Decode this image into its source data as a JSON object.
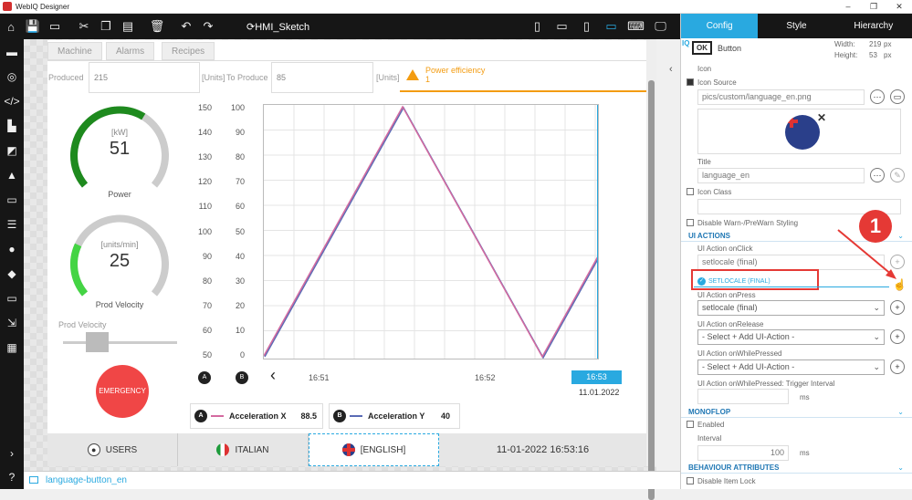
{
  "window": {
    "title": "WebIQ Designer",
    "controls": [
      "–",
      "❐",
      "✕"
    ]
  },
  "toolbar": {
    "project": "HMI_Sketch",
    "icons": [
      "home-icon",
      "save-icon",
      "monitor-icon",
      "cut-icon",
      "copy-icon",
      "paste-icon",
      "delete-icon",
      "undo-icon",
      "redo-icon"
    ],
    "devices": [
      "phone-portrait-icon",
      "phone-landscape-icon",
      "tablet-portrait-icon",
      "tablet-landscape-icon",
      "laptop-icon",
      "desktop-icon"
    ]
  },
  "sidebar": {
    "icons": [
      "widgets-icon",
      "globe-icon",
      "code-icon",
      "factory-icon",
      "trend-icon",
      "alarm-icon",
      "tag-icon",
      "list-icon",
      "user-icon",
      "cube-icon",
      "screen-icon",
      "import-icon",
      "grid-icon"
    ],
    "bottom": [
      "chevron-right-icon",
      "help-icon"
    ]
  },
  "hmi": {
    "tabs": [
      "Machine",
      "Alarms",
      "Recipes"
    ],
    "produced": {
      "label": "Produced",
      "value": "215",
      "unit": "[Units]"
    },
    "to_produce": {
      "label": "To Produce",
      "value": "85",
      "unit": "[Units]"
    },
    "warning": {
      "title": "Power efficiency",
      "value": "1"
    },
    "gauge1": {
      "unit": "[kW]",
      "value": "51",
      "label": "Power",
      "fraction": 0.62,
      "color": "#1e8a1e"
    },
    "gauge2": {
      "unit": "[units/min]",
      "value": "25",
      "label": "Prod Velocity",
      "fraction": 0.25,
      "color": "#44d444"
    },
    "slider": {
      "label": "Prod Velocity",
      "fraction": 0.25
    },
    "emergency": "EMERGENCY",
    "axis_a": [
      "150",
      "140",
      "130",
      "120",
      "110",
      "100",
      "90",
      "80",
      "70",
      "60",
      "50"
    ],
    "axis_b": [
      "100",
      "90",
      "80",
      "70",
      "60",
      "50",
      "40",
      "30",
      "20",
      "10",
      "0"
    ],
    "x_labels": [
      "16:51",
      "16:52",
      "16:53"
    ],
    "date": "11.01.2022",
    "marker_a": "A",
    "marker_b": "B",
    "nav_prev": "‹",
    "legend": [
      {
        "marker": "A",
        "name": "Acceleration X",
        "value": "88.5",
        "color": "#d46aa0"
      },
      {
        "marker": "B",
        "name": "Acceleration Y",
        "value": "40",
        "color": "#5a6bb5"
      }
    ],
    "bottom": {
      "users": "USERS",
      "italian": "ITALIAN",
      "english": "[ENGLISH]",
      "datetime": "11-01-2022 16:53:16"
    }
  },
  "status": {
    "selected": "language-button_en"
  },
  "panel": {
    "tabs": [
      "Config",
      "Style",
      "Hierarchy"
    ],
    "widget": {
      "badge": "OK",
      "type": "Button",
      "width_label": "Width:",
      "width": "219",
      "height_label": "Height:",
      "height": "53",
      "unit": "px",
      "id_label": "IQ"
    },
    "icon_label": "Icon",
    "icon_source_label": "Icon Source",
    "icon_source": "pics/custom/language_en.png",
    "title_label": "Title",
    "title": "language_en",
    "icon_class_label": "Icon Class",
    "disable_warn": "Disable Warn-/PreWarn Styling",
    "ui_actions": "UI ACTIONS",
    "onclick_label": "UI Action onClick",
    "onclick_value": "setlocale (final)",
    "onclick_badge": "SETLOCALE (FINAL)",
    "onpress_label": "UI Action onPress",
    "onpress_value": "setlocale (final)",
    "onrelease_label": "UI Action onRelease",
    "onrelease_value": "- Select + Add UI-Action -",
    "onwhile_label": "UI Action onWhilePressed",
    "onwhile_value": "- Select + Add UI-Action -",
    "trigger_label": "UI Action onWhilePressed: Trigger Interval",
    "trigger_unit": "ms",
    "monoflop": "MONOFLOP",
    "enabled_label": "Enabled",
    "interval_label": "Interval",
    "interval_value": "100",
    "interval_unit": "ms",
    "behaviour": "BEHAVIOUR ATTRIBUTES",
    "disable_lock": "Disable Item Lock",
    "annotation": "1"
  }
}
